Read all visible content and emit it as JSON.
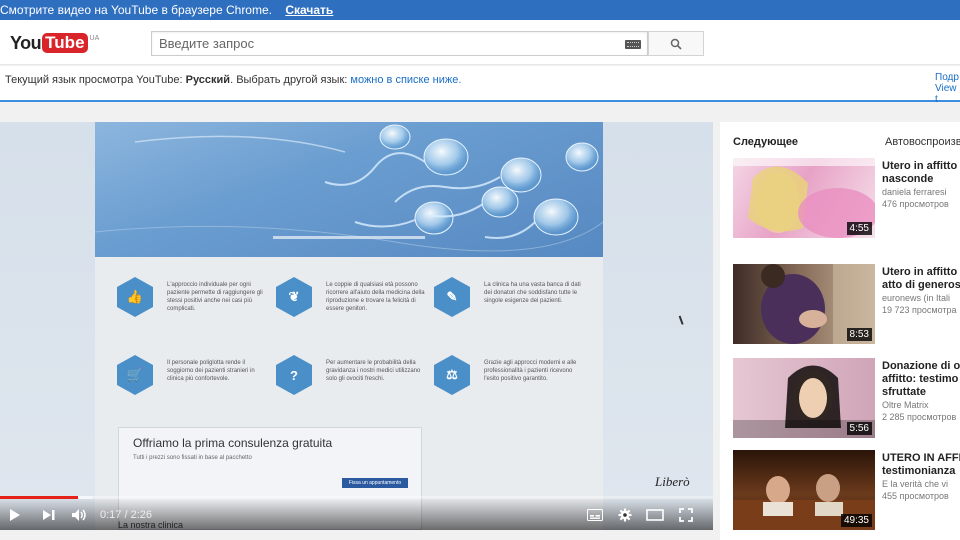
{
  "banner": {
    "message": "Смотрите видео на YouTube в браузере Chrome.",
    "download_label": "Скачать"
  },
  "header": {
    "logo_you": "You",
    "logo_tube": "Tube",
    "logo_region": "UA",
    "search_placeholder": "Введите запрос"
  },
  "language_bar": {
    "prefix": "Текущий язык просмотра YouTube: ",
    "language": "Русский",
    "middle": ". Выбрать другой язык: ",
    "link": "можно в списке ниже.",
    "right_line1": "Подр",
    "right_line2": "View t"
  },
  "video": {
    "features": [
      {
        "icon": "thumbs-up-icon",
        "glyph": "👍",
        "text": "L'approccio individuale per ogni paziente permette di raggiungere gli stessi positivi anche nei casi più complicati."
      },
      {
        "icon": "leaf-icon",
        "glyph": "❦",
        "text": "Le coppie di qualsiasi età possono ricorrere all'aiuto della medicina della riproduzione e trovare la felicità di essere genitori."
      },
      {
        "icon": "syringe-icon",
        "glyph": "✎",
        "text": "La clinica ha una vasta banca di dati dei donatori che soddisfano tutte le singole esigenze dei pazienti."
      },
      {
        "icon": "cart-icon",
        "glyph": "🛒",
        "text": "Il personale poliglotta rende il soggiorno dei pazienti stranieri in clinica più confortevole."
      },
      {
        "icon": "question-icon",
        "glyph": "?",
        "text": "Per aumentare le probabilità della gravidanza i nostri medici utilizzano solo gli ovociti freschi."
      },
      {
        "icon": "scales-icon",
        "glyph": "⚖",
        "text": "Grazie agli approcci moderni e alle professionalità i pazienti ricevono l'esito positivo garantito."
      }
    ],
    "offer_title": "Offriamo la prima consulenza gratuita",
    "offer_sub": "Tutti i prezzi sono fissati in base al pacchetto",
    "offer_button": "Fissa un appuntamento",
    "brand": "Liberò",
    "caption": "La nostra clinica",
    "current_time": "0:17",
    "duration": "2:26",
    "time_display": "0:17 / 2:26",
    "progress": 0.11,
    "loaded": 0.09
  },
  "sidebar": {
    "next_label": "Следующее",
    "autoplay_label": "Автовоспроизведение",
    "items": [
      {
        "title1": "Utero in affitto",
        "title2": "nasconde",
        "channel": "daniela ferraresi",
        "views": "476 просмотров",
        "duration": "4:55",
        "thumb_color": "#d9a3c6"
      },
      {
        "title1": "Utero in affitto",
        "title2": "atto di generos",
        "channel": "euronews (in Itali",
        "views": "19 723 просмотра",
        "duration": "8:53",
        "thumb_color": "#7a5a4a"
      },
      {
        "title1": "Donazione di o",
        "title2": "affitto: testimo",
        "title3": "sfruttate",
        "channel": "Oltre Matrix",
        "views": "2 285 просмотров",
        "duration": "5:56",
        "thumb_color": "#d8b7c6"
      },
      {
        "title1": "UTERO IN AFFI",
        "title2": "testimonianza",
        "channel": "E la verità che vi",
        "views": "455 просмотров",
        "duration": "49:35",
        "thumb_color": "#5a3320"
      }
    ]
  }
}
